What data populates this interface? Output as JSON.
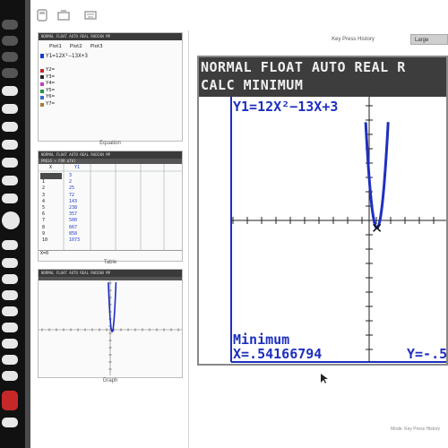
{
  "left_panels": {
    "equation": {
      "header": "NORMAL FLOAT AUTO REAL RADIAN MP",
      "plot_labels": [
        "Plot1",
        "Plot2",
        "Plot3"
      ],
      "y1": "Y1=12X²−13X+3",
      "empty_rows": [
        "Y2=",
        "Y3=",
        "Y4=",
        "Y5=",
        "Y6=",
        "Y7="
      ],
      "row_colors": [
        "#1e3cc8",
        "#c82828",
        "#2a2a2a",
        "#c040c0",
        "#1e9a3c",
        "#3070c8",
        "#b07830"
      ],
      "caption": "Equation"
    },
    "table": {
      "header": "NORMAL FLOAT AUTO REAL RADIAN MP",
      "subheader": "PRESS + FOR ΔTbl",
      "columns": [
        "X",
        "Y1"
      ],
      "x_values": [
        "0",
        "1",
        "2",
        "3",
        "4",
        "5",
        "6",
        "7",
        "8",
        "9",
        "10"
      ],
      "y_values": [
        "3",
        "2",
        "25",
        "72",
        "143",
        "238",
        "357",
        "500",
        "667",
        "858",
        "1073"
      ],
      "footer": "X=0",
      "caption": "Table"
    },
    "graph": {
      "header": "NORMAL FLOAT AUTO REAL RADIAN MP",
      "caption": "Graph"
    }
  },
  "tabs": {
    "history": "Key Press History",
    "large": "Large"
  },
  "screen": {
    "line1": "NORMAL FLOAT AUTO REAL R",
    "line2": "CALC MINIMUM",
    "function_label": "Y1=12X²−13X+3",
    "result_title": "Minimum",
    "x_result": "X=.54166794",
    "y_result": "Y=-.5",
    "colors": {
      "lcd_dark": "#3d3d3d",
      "lcd_text": "#f0f0f0",
      "curve": "#1e2fbf",
      "result_text": "#1e2fbf",
      "border_blue": "#1e2fbf"
    }
  },
  "status_text": "Mode: Key Press History"
}
